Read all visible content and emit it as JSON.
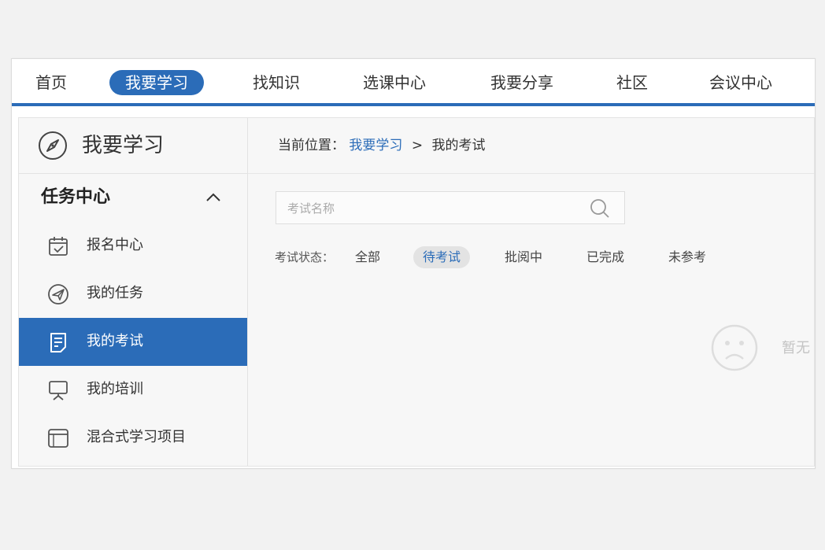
{
  "topnav": {
    "items": [
      {
        "label": "首页"
      },
      {
        "label": "我要学习"
      },
      {
        "label": "找知识"
      },
      {
        "label": "选课中心"
      },
      {
        "label": "我要分享"
      },
      {
        "label": "社区"
      },
      {
        "label": "会议中心"
      }
    ],
    "active_index": 1
  },
  "sidebar": {
    "title": "我要学习",
    "section": {
      "label": "任务中心"
    },
    "items": [
      {
        "label": "报名中心",
        "icon": "calendar-check-icon"
      },
      {
        "label": "我的任务",
        "icon": "paper-plane-icon"
      },
      {
        "label": "我的考试",
        "icon": "exam-document-icon"
      },
      {
        "label": "我的培训",
        "icon": "presentation-board-icon"
      },
      {
        "label": "混合式学习项目",
        "icon": "browser-window-icon"
      }
    ],
    "active_index": 2
  },
  "breadcrumb": {
    "prefix": "当前位置：",
    "link": "我要学习",
    "separator": ">",
    "current": "我的考试"
  },
  "search": {
    "placeholder": "考试名称",
    "value": ""
  },
  "filters": {
    "label": "考试状态：",
    "options": [
      "全部",
      "待考试",
      "批阅中",
      "已完成",
      "未参考"
    ],
    "active_index": 1
  },
  "empty_state": {
    "text": "暂无"
  },
  "colors": {
    "accent": "#2b6cb8",
    "page_bg": "#f2f2f2",
    "active_filter_bg": "#e3e3e3"
  }
}
